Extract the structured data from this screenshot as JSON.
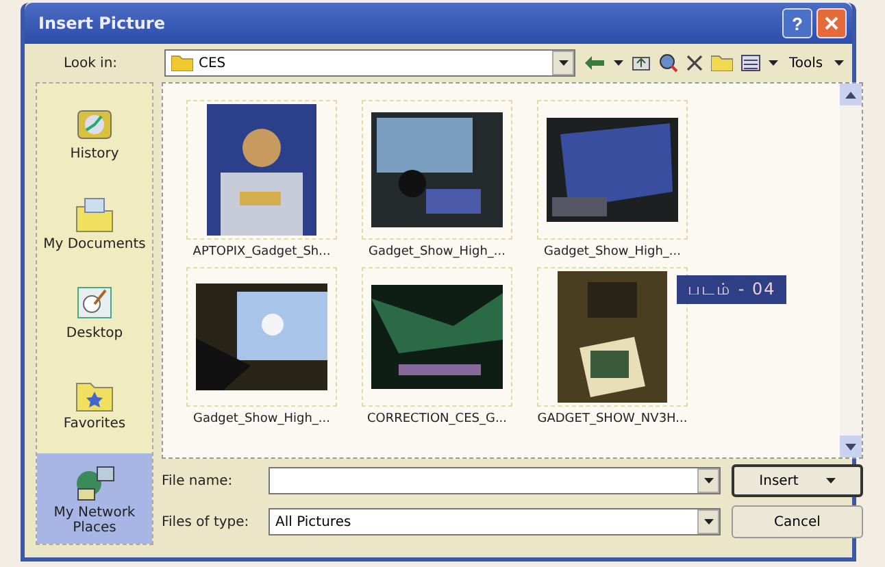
{
  "window": {
    "title": "Insert Picture",
    "help_button": "?"
  },
  "toolbar": {
    "look_in_label": "Look in:",
    "folder": "CES",
    "tools": "Tools"
  },
  "sidebar": {
    "items": [
      {
        "label": "History",
        "kind": "history",
        "selected": false
      },
      {
        "label": "My Documents",
        "kind": "documents",
        "selected": false
      },
      {
        "label": "Desktop",
        "kind": "desktop",
        "selected": false
      },
      {
        "label": "Favorites",
        "kind": "favorites",
        "selected": false
      },
      {
        "label": "My Network Places",
        "kind": "network",
        "selected": true
      }
    ]
  },
  "files": [
    {
      "name": "APTOPIX_Gadget_Sh..."
    },
    {
      "name": "Gadget_Show_High_..."
    },
    {
      "name": "Gadget_Show_High_..."
    },
    {
      "name": "Gadget_Show_High_..."
    },
    {
      "name": "CORRECTION_CES_G..."
    },
    {
      "name": "GADGET_SHOW_NV3H..."
    }
  ],
  "file_name": {
    "label": "File name:"
  },
  "files_of_type": {
    "label": "Files of type:",
    "value": "All Pictures"
  },
  "buttons": [
    {
      "label": "Insert",
      "kind": "split"
    },
    {
      "label": "Cancel",
      "kind": "plain"
    }
  ],
  "caption": "படம் - 04"
}
